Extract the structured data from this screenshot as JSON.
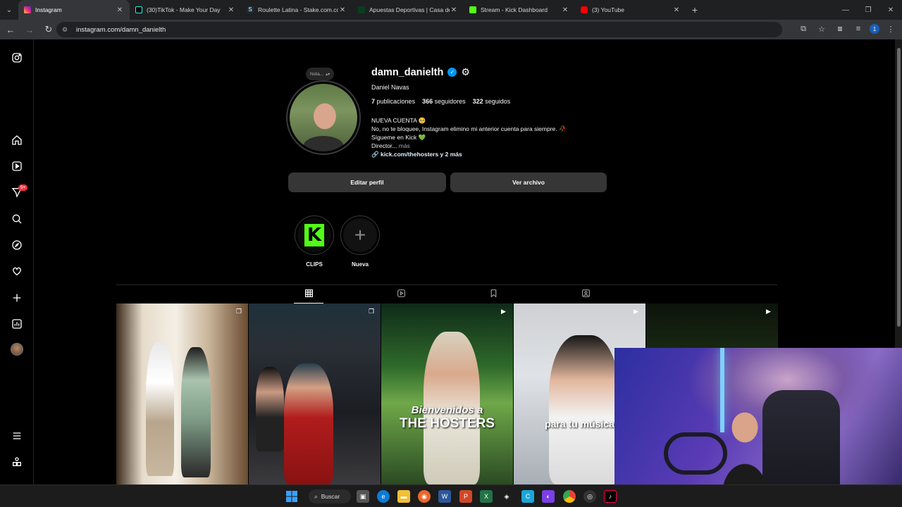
{
  "browser": {
    "tabs": [
      {
        "label": "Instagram",
        "color": "#e1306c",
        "active": true
      },
      {
        "label": "(30)TikTok - Make Your Day",
        "color": "#111111",
        "active": false
      },
      {
        "label": "Roulette Latina - Stake.com.co",
        "color": "#1a2c38",
        "active": false
      },
      {
        "label": "Apuestas Deportivas | Casa de",
        "color": "#0b3d1f",
        "active": false
      },
      {
        "label": "Stream - Kick Dashboard",
        "color": "#53fc18",
        "active": false
      },
      {
        "label": "(3) YouTube",
        "color": "#ff0000",
        "active": false
      }
    ],
    "url": "instagram.com/damn_danielth",
    "profile_initial": "1"
  },
  "profile": {
    "note": "Nota...",
    "username": "damn_danielth",
    "full_name": "Daniel Navas",
    "posts_count": "7",
    "posts_label": "publicaciones",
    "followers_count": "366",
    "followers_label": "seguidores",
    "following_count": "322",
    "following_label": "seguidos",
    "bio": [
      "NUEVA CUENTA 🥺",
      "No, no te bloquee, Instagram elimino mi anterior cuenta para siempre. 🥀",
      "Sígueme en Kick 💚",
      "Director..."
    ],
    "bio_more": " más",
    "link": "kick.com/thehosters y 2 más",
    "edit_button": "Editar perfil",
    "archive_button": "Ver archivo"
  },
  "highlights": [
    {
      "label": "CLIPS"
    },
    {
      "label": "Nueva"
    }
  ],
  "posts": [
    {
      "caption": ""
    },
    {
      "caption": ""
    },
    {
      "caption": "Bienvenidos a\nTHE HOSTERS"
    },
    {
      "caption": "para tu música"
    },
    {
      "caption": ""
    }
  ],
  "post_captions": {
    "p3_line1": "Bienvenidos a",
    "p3_line2": "THE HOSTERS",
    "p4": "para tu música"
  },
  "nav_badge": "9+",
  "taskbar": {
    "search_label": "Buscar"
  },
  "colors": {
    "verified": "#0095f6",
    "kick_green": "#53fc18",
    "badge": "#ff3040"
  }
}
